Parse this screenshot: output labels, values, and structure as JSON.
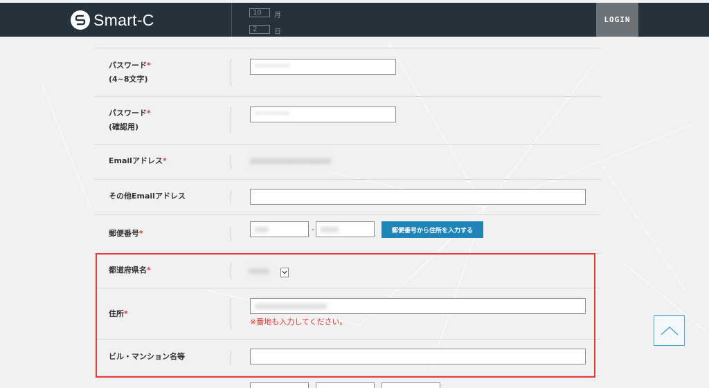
{
  "header": {
    "logo_text": "Smart-C",
    "login_label": "LOGIN",
    "peek_month": "10",
    "peek_month_unit": "月",
    "peek_day": "2",
    "peek_day_unit": "日"
  },
  "form": {
    "password": {
      "label": "パスワード",
      "required_mark": "*",
      "sub_label": "(4~8文字)",
      "value": "••••••••"
    },
    "password_confirm": {
      "label": "パスワード",
      "required_mark": "*",
      "sub_label": "(確認用)",
      "value": "••••••••"
    },
    "email": {
      "label": "Emailアドレス",
      "required_mark": "*",
      "value": "xxxxxxxxxxxxxxxxxx"
    },
    "other_email": {
      "label": "その他Emailアドレス",
      "value": ""
    },
    "postal": {
      "label": "郵便番号",
      "required_mark": "*",
      "part1": "xxx",
      "separator": "-",
      "part2": "xxxx",
      "button_label": "郵便番号から住所を入力する"
    },
    "prefecture": {
      "label": "都道府県名",
      "required_mark": "*",
      "value": "xxxxx"
    },
    "address": {
      "label": "住所",
      "required_mark": "*",
      "value": "xxxxxxxxxxxxxxxx",
      "note": "※番地も入力してください。"
    },
    "building": {
      "label": "ビル・マンション名等",
      "value": ""
    }
  },
  "colors": {
    "header_bg": "#25313b",
    "login_bg": "#6b7378",
    "accent_button": "#1f84b8",
    "required": "#d9362d",
    "highlight_border": "#e8383d"
  },
  "icons": {
    "logo": "smart-c-logo-icon",
    "select_arrow": "chevron-down-icon",
    "scroll_top": "chevron-up-icon"
  }
}
